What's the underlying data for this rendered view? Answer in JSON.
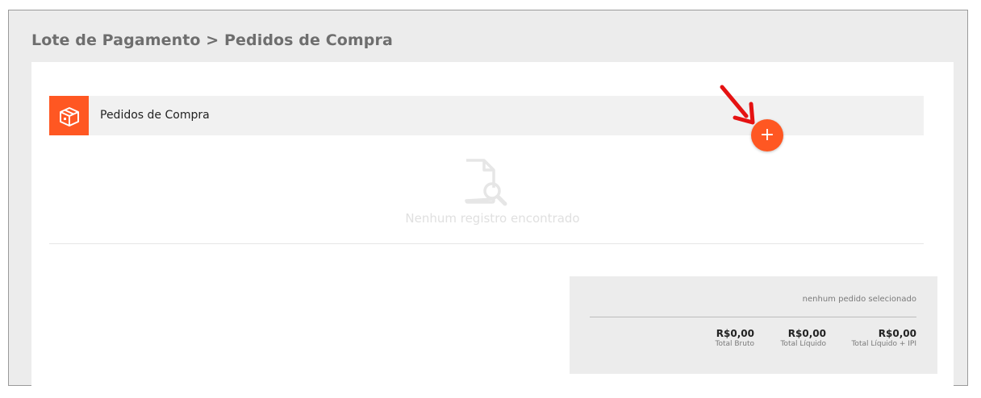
{
  "breadcrumb": "Lote de Pagamento > Pedidos de Compra",
  "panel": {
    "title": "Pedidos de Compra",
    "icon": "box-icon",
    "add_label": "+"
  },
  "empty": {
    "icon": "document-search-icon",
    "text": "Nenhum registro encontrado"
  },
  "summary": {
    "status": "nenhum pedido selecionado",
    "totals": [
      {
        "value": "R$0,00",
        "label": "Total Bruto"
      },
      {
        "value": "R$0,00",
        "label": "Total Líquido"
      },
      {
        "value": "R$0,00",
        "label": "Total Líquido + IPI"
      }
    ]
  },
  "colors": {
    "accent": "#ff5722",
    "page_bg": "#ececec",
    "panel_bg": "#f1f1f1"
  }
}
